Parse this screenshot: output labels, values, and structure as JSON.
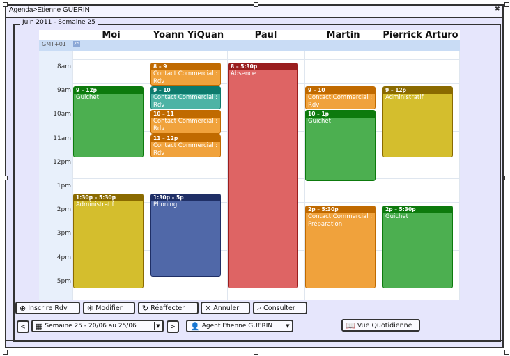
{
  "window": {
    "title": "Agenda>Etienne GUERIN",
    "close_icon": "pin-icon"
  },
  "group": {
    "legend": "Juin 2011 - Semaine 25"
  },
  "calendar": {
    "timezone": "GMT+01",
    "week_badge": "25",
    "columns": [
      "Moi",
      "Yoann YiQuan",
      "Paul",
      "Martin",
      "Pierrick Arturo"
    ],
    "time_labels": [
      "8am",
      "9am",
      "10am",
      "11am",
      "12pm",
      "1pm",
      "2pm",
      "3pm",
      "4pm",
      "5pm"
    ],
    "events": [
      {
        "col": 0,
        "start": 9,
        "end": 12,
        "time": "9 – 12p",
        "title": "Guichet",
        "color": "#4caf50",
        "head_color": "#0d7a0d"
      },
      {
        "col": 0,
        "start": 13.5,
        "end": 17.5,
        "time": "1:30p – 5:30p",
        "title": "Administratif",
        "color": "#d4be2d",
        "head_color": "#8a6a00"
      },
      {
        "col": 1,
        "start": 8,
        "end": 9,
        "time": "8 – 9",
        "title": "Contact Commercial : Rdv",
        "color": "#f0a23c",
        "head_color": "#c06a00"
      },
      {
        "col": 1,
        "start": 9,
        "end": 10,
        "time": "9 – 10",
        "title": "Contact Commercial : Rdv",
        "color": "#4db3a5",
        "head_color": "#0d7a6d"
      },
      {
        "col": 1,
        "start": 10,
        "end": 11,
        "time": "10 – 11",
        "title": "Contact Commercial : Rdv",
        "color": "#f0a23c",
        "head_color": "#c06a00"
      },
      {
        "col": 1,
        "start": 11,
        "end": 12,
        "time": "11 – 12p",
        "title": "Contact Commercial : Rdv",
        "color": "#f0a23c",
        "head_color": "#c06a00"
      },
      {
        "col": 1,
        "start": 13.5,
        "end": 17,
        "time": "1:30p – 5p",
        "title": "Phoning",
        "color": "#5068a8",
        "head_color": "#1f2f66"
      },
      {
        "col": 2,
        "start": 8,
        "end": 17.5,
        "time": "8 – 5:30p",
        "title": "Absence",
        "color": "#de6464",
        "head_color": "#9a1e1e"
      },
      {
        "col": 3,
        "start": 9,
        "end": 10,
        "time": "9 – 10",
        "title": "Contact Commercial : Rdv",
        "color": "#f0a23c",
        "head_color": "#c06a00"
      },
      {
        "col": 3,
        "start": 10,
        "end": 13,
        "time": "10 – 1p",
        "title": "Guichet",
        "color": "#4caf50",
        "head_color": "#0d7a0d"
      },
      {
        "col": 3,
        "start": 14,
        "end": 17.5,
        "time": "2p – 5:30p",
        "title": "Contact Commercial : Préparation",
        "color": "#f0a23c",
        "head_color": "#c06a00"
      },
      {
        "col": 4,
        "start": 9,
        "end": 12,
        "time": "9 – 12p",
        "title": "Administratif",
        "color": "#d4be2d",
        "head_color": "#8a6a00"
      },
      {
        "col": 4,
        "start": 14,
        "end": 17.5,
        "time": "2p – 5:30p",
        "title": "Guichet",
        "color": "#4caf50",
        "head_color": "#0d7a0d"
      }
    ]
  },
  "toolbar": {
    "inscrire": {
      "label": "Inscrire Rdv",
      "icon": "plus-circle-icon"
    },
    "modifier": {
      "label": "Modifier",
      "icon": "sparkle-icon"
    },
    "reaffecter": {
      "label": "Réaffecter",
      "icon": "rotate-icon"
    },
    "annuler": {
      "label": "Annuler",
      "icon": "x-icon"
    },
    "consulter": {
      "label": "Consulter",
      "icon": "magnifier-icon"
    }
  },
  "nav": {
    "prev": "<",
    "week": "Semaine 25 - 20/06 au 25/06",
    "next": ">",
    "agent": "Agent Etienne GUERIN",
    "view": "Vue Quotidienne"
  }
}
